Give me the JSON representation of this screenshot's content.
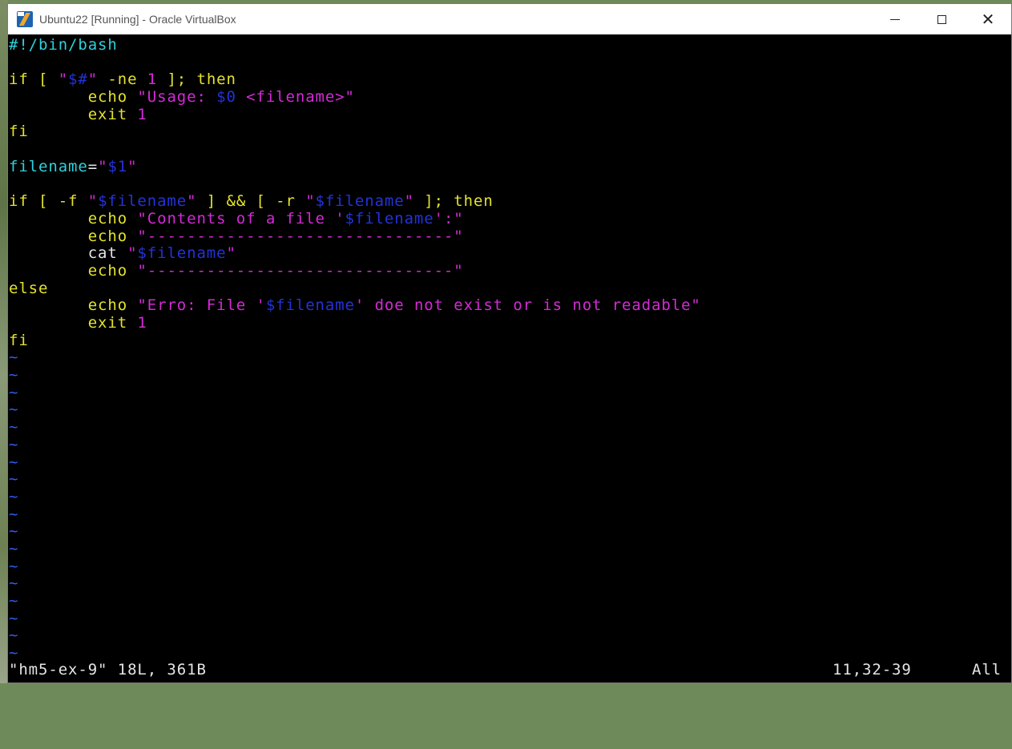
{
  "window": {
    "title": "Ubuntu22 [Running] - Oracle VirtualBox",
    "controls": {
      "minimize": "",
      "maximize": "",
      "close": "✕"
    }
  },
  "editor": {
    "lines": [
      [
        {
          "t": "#!/bin/bash",
          "c": "c-cyan"
        }
      ],
      [],
      [
        {
          "t": "if [ ",
          "c": "c-yellow"
        },
        {
          "t": "\"",
          "c": "c-mag"
        },
        {
          "t": "$#",
          "c": "c-blue"
        },
        {
          "t": "\"",
          "c": "c-mag"
        },
        {
          "t": " -ne ",
          "c": "c-yellow"
        },
        {
          "t": "1",
          "c": "c-mag"
        },
        {
          "t": " ]; then",
          "c": "c-yellow"
        }
      ],
      [
        {
          "t": "        echo ",
          "c": "c-yellow"
        },
        {
          "t": "\"Usage: ",
          "c": "c-mag"
        },
        {
          "t": "$0",
          "c": "c-blue"
        },
        {
          "t": " <filename>\"",
          "c": "c-mag"
        }
      ],
      [
        {
          "t": "        exit ",
          "c": "c-yellow"
        },
        {
          "t": "1",
          "c": "c-mag"
        }
      ],
      [
        {
          "t": "fi",
          "c": "c-yellow"
        }
      ],
      [],
      [
        {
          "t": "filename",
          "c": "c-cyan"
        },
        {
          "t": "=",
          "c": "c-white"
        },
        {
          "t": "\"",
          "c": "c-mag"
        },
        {
          "t": "$1",
          "c": "c-blue"
        },
        {
          "t": "\"",
          "c": "c-mag"
        }
      ],
      [],
      [
        {
          "t": "if [ -f ",
          "c": "c-yellow"
        },
        {
          "t": "\"",
          "c": "c-mag"
        },
        {
          "t": "$filename",
          "c": "c-blue"
        },
        {
          "t": "\"",
          "c": "c-mag"
        },
        {
          "t": " ] && [ -r ",
          "c": "c-yellow"
        },
        {
          "t": "\"",
          "c": "c-mag"
        },
        {
          "t": "$filename",
          "c": "c-blue"
        },
        {
          "t": "\"",
          "c": "c-mag"
        },
        {
          "t": " ]; then",
          "c": "c-yellow"
        }
      ],
      [
        {
          "t": "        echo ",
          "c": "c-yellow"
        },
        {
          "t": "\"Contents of a file '",
          "c": "c-mag"
        },
        {
          "t": "$filename",
          "c": "c-blue"
        },
        {
          "t": "':\"",
          "c": "c-mag"
        }
      ],
      [
        {
          "t": "        echo ",
          "c": "c-yellow"
        },
        {
          "t": "\"-------------------------------\"",
          "c": "c-mag"
        }
      ],
      [
        {
          "t": "        cat ",
          "c": "c-white"
        },
        {
          "t": "\"",
          "c": "c-mag"
        },
        {
          "t": "$filename",
          "c": "c-blue"
        },
        {
          "t": "\"",
          "c": "c-mag"
        }
      ],
      [
        {
          "t": "        echo ",
          "c": "c-yellow"
        },
        {
          "t": "\"-------------------------------\"",
          "c": "c-mag"
        }
      ],
      [
        {
          "t": "else",
          "c": "c-yellow"
        }
      ],
      [
        {
          "t": "        echo ",
          "c": "c-yellow"
        },
        {
          "t": "\"Erro: File '",
          "c": "c-mag"
        },
        {
          "t": "$filename",
          "c": "c-blue"
        },
        {
          "t": "' doe not exist or is not readable\"",
          "c": "c-mag"
        }
      ],
      [
        {
          "t": "        exit ",
          "c": "c-yellow"
        },
        {
          "t": "1",
          "c": "c-mag"
        }
      ],
      [
        {
          "t": "fi",
          "c": "c-yellow"
        }
      ]
    ],
    "tilde_char": "~",
    "tilde_count": 18
  },
  "status": {
    "file_info": "\"hm5-ex-9\" 18L, 361B",
    "cursor_pos": "11,32-39",
    "scroll": "All"
  },
  "colors": {
    "background": "#000000",
    "cyan": "#2fd1dc",
    "yellow": "#e3e22f",
    "magenta": "#d42ad6",
    "blue": "#2432d8",
    "tilde": "#2f5cf2"
  }
}
